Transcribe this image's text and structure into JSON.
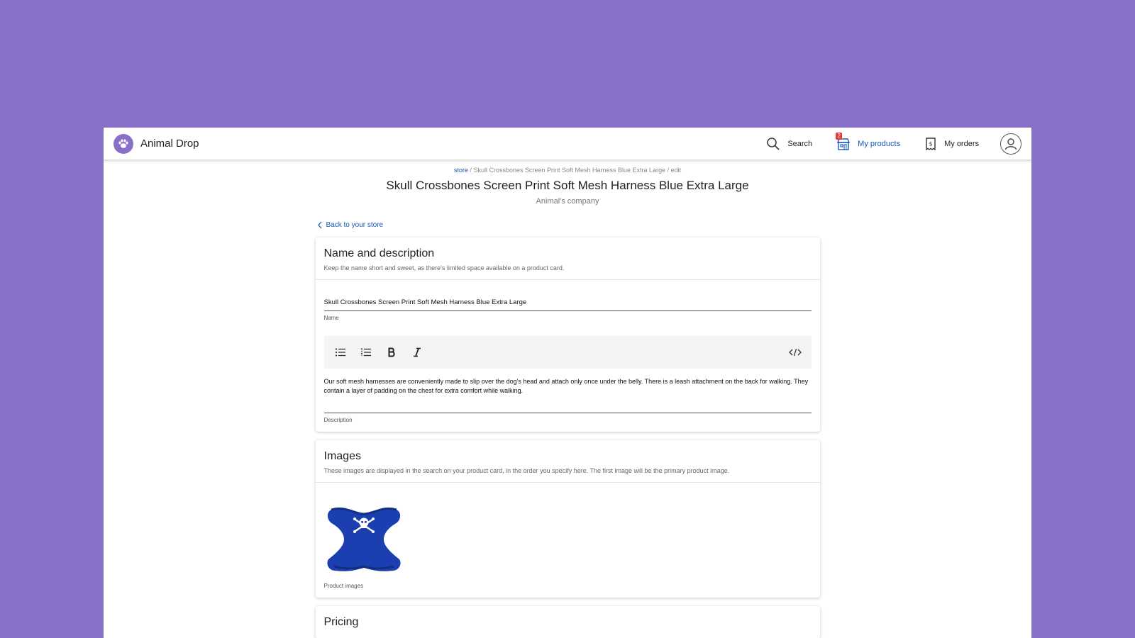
{
  "app": {
    "name": "Animal Drop"
  },
  "nav": {
    "search_label": "Search",
    "products_label": "My products",
    "products_badge": "2",
    "orders_label": "My orders"
  },
  "breadcrumb": {
    "store": "store",
    "sep1": "/",
    "product": "Skull Crossbones Screen Print Soft Mesh Harness Blue Extra Large",
    "sep2": "/",
    "edit": "edit"
  },
  "page": {
    "title": "Skull Crossbones Screen Print Soft Mesh Harness Blue Extra Large",
    "company": "Animal's company",
    "back_label": "Back to your store"
  },
  "name_card": {
    "title": "Name and description",
    "subtitle": "Keep the name short and sweet, as there's limited space available on a product card.",
    "name_value": "Skull Crossbones Screen Print Soft Mesh Harness Blue Extra Large",
    "name_label": "Name",
    "description_value": "Our soft mesh harnesses are conveniently made to slip over the dog's head and attach only once under the belly. There is a leash attachment on the back for walking. They contain a layer of padding on the chest for extra comfort while walking.",
    "description_label": "Description"
  },
  "images_card": {
    "title": "Images",
    "subtitle": "These images are displayed in the search on your product card, in the order you specify here. The first image will be the primary product image.",
    "label": "Product images"
  },
  "pricing_card": {
    "title": "Pricing"
  },
  "colors": {
    "accent": "#8870c9",
    "link": "#1a57b8",
    "badge": "#e53935",
    "harness": "#1b3fb0"
  }
}
